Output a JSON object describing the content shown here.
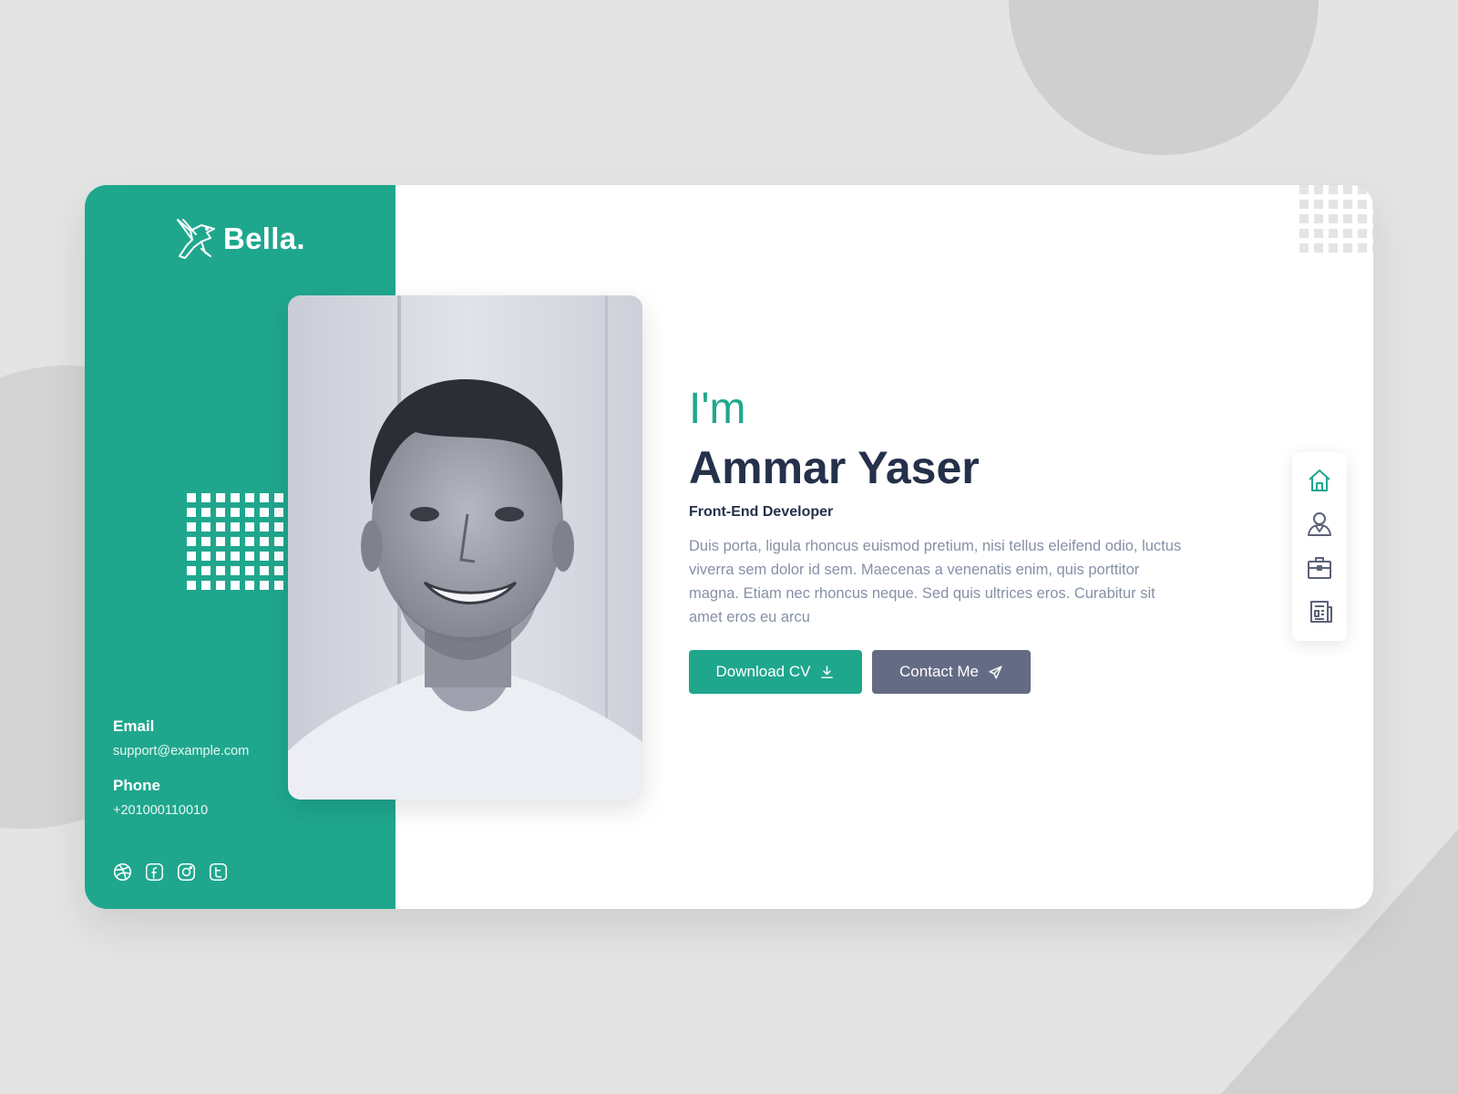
{
  "brand": {
    "name": "Bella."
  },
  "hero": {
    "greeting": "I'm",
    "name": "Ammar Yaser",
    "role": "Front-End Developer",
    "bio": "Duis porta, ligula rhoncus euismod pretium, nisi tellus eleifend odio, luctus viverra sem dolor id sem. Maecenas a venenatis enim, quis porttitor magna. Etiam nec rhoncus neque. Sed quis ultrices eros. Curabitur sit amet eros eu arcu"
  },
  "buttons": {
    "download": "Download CV",
    "contact": "Contact Me"
  },
  "contact": {
    "email_label": "Email",
    "email_value": "support@example.com",
    "phone_label": "Phone",
    "phone_value": "+201000110010"
  },
  "socials": [
    "dribbble-icon",
    "facebook-icon",
    "instagram-icon",
    "twitter-icon"
  ],
  "nav": [
    "home-icon",
    "user-icon",
    "briefcase-icon",
    "newspaper-icon"
  ],
  "colors": {
    "accent": "#1fa78e",
    "heading": "#25304a",
    "muted": "#8690a6",
    "secondary_button": "#646c85",
    "background": "#e4e4e4"
  }
}
